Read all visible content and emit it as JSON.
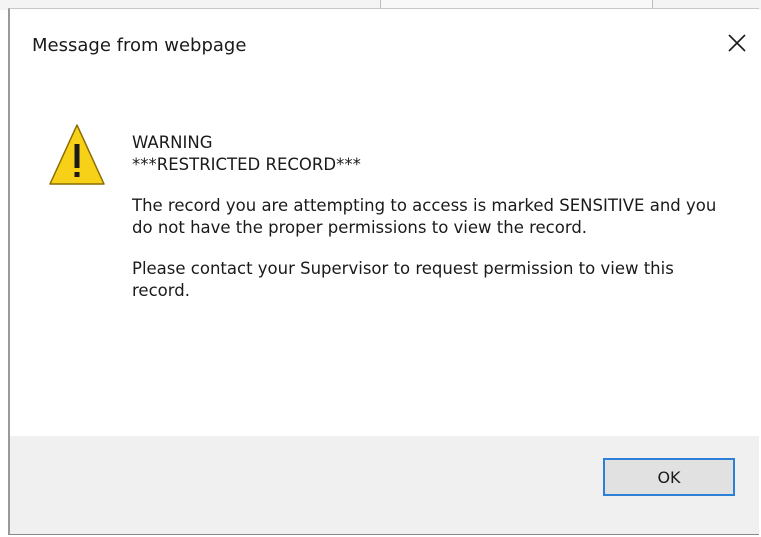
{
  "dialog": {
    "title": "Message from webpage",
    "close_icon": "close-icon",
    "warning_icon": "warning-triangle-icon",
    "heading_line1": "WARNING",
    "heading_line2": "***RESTRICTED RECORD***",
    "paragraph1": "The record you are attempting to access is marked SENSITIVE and you do not have the proper permissions to view the record.",
    "paragraph2": "Please contact your Supervisor to request permission to view this record.",
    "ok_label": "OK"
  },
  "colors": {
    "warning_fill": "#F7D117",
    "warning_outline": "#8a6d00",
    "ok_border": "#2E7FD6",
    "footer_bg": "#F0F0F0"
  }
}
